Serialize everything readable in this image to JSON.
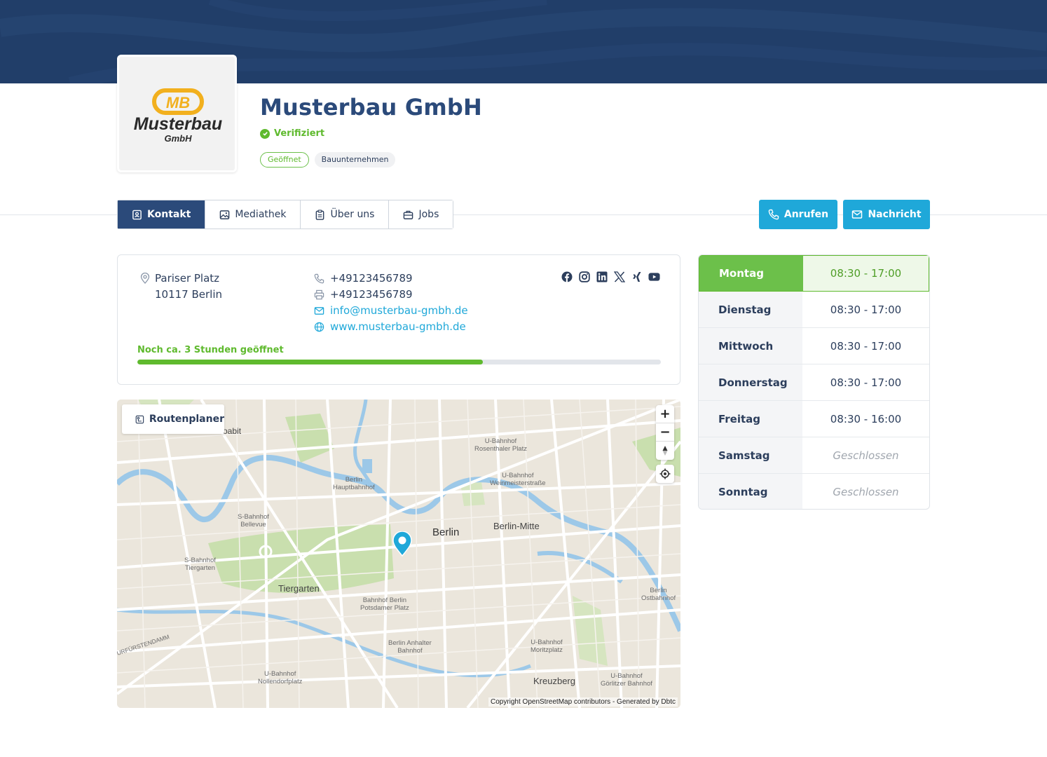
{
  "company": {
    "name": "Musterbau GmbH",
    "verified_label": "Verifiziert",
    "logo_text_main": "Musterbau",
    "logo_text_sub": "GmbH",
    "logo_monogram": "MB",
    "tags": {
      "status": "Geöffnet",
      "category": "Bauunternehmen"
    }
  },
  "tabs": [
    {
      "label": "Kontakt",
      "icon": "contact-card-icon",
      "active": true
    },
    {
      "label": "Mediathek",
      "icon": "image-icon"
    },
    {
      "label": "Über uns",
      "icon": "clipboard-icon"
    },
    {
      "label": "Jobs",
      "icon": "briefcase-icon"
    }
  ],
  "actions": {
    "call_label": "Anrufen",
    "message_label": "Nachricht"
  },
  "contact": {
    "street": "Pariser Platz",
    "city": "10117 Berlin",
    "phone": "+49123456789",
    "fax": "+49123456789",
    "email": "info@musterbau-gmbh.de",
    "website": "www.musterbau-gmbh.de",
    "open_note": "Noch ca. 3 Stunden geöffnet",
    "open_progress_percent": 66,
    "socials": [
      "facebook-icon",
      "instagram-icon",
      "linkedin-icon",
      "x-icon",
      "xing-icon",
      "youtube-icon"
    ]
  },
  "map": {
    "route_label": "Routenplaner",
    "attribution": "Copyright OpenStreetMap contributors - Generated by Dbtc",
    "zoom_in": "+",
    "zoom_out": "−",
    "labels": {
      "moabit": "...oabit",
      "rosenthaler_1": "U-Bahnhof",
      "rosenthaler_2": "Rosenthaler Platz",
      "weinmeister_1": "U-Bahnhof",
      "weinmeister_2": "Weinmeisterstraße",
      "hbf_1": "Berlin",
      "hbf_2": "Hauptbahnhof",
      "bellevue_1": "S-Bahnhof",
      "bellevue_2": "Bellevue",
      "berlin": "Berlin",
      "berlin_mitte": "Berlin-Mitte",
      "tiergarten_s_1": "S-Bahnhof",
      "tiergarten_s_2": "Tiergarten",
      "tiergarten": "Tiergarten",
      "potsdamer_1": "Bahnhof Berlin",
      "potsdamer_2": "Potsdamer Platz",
      "ostbahnhof_1": "Berlin",
      "ostbahnhof_2": "Ostbahnhof",
      "kudamm": "URFÜRSTENDAMM",
      "anhalter_1": "Berlin Anhalter",
      "anhalter_2": "Bahnhof",
      "moritzplatz_1": "U-Bahnhof",
      "moritzplatz_2": "Moritzplatz",
      "nollendorf_1": "U-Bahnhof",
      "nollendorf_2": "Nollendorfplatz",
      "kreuzberg": "Kreuzberg",
      "goerlitzer_1": "U-Bahnhof",
      "goerlitzer_2": "Görlitzer Bahnhof"
    }
  },
  "hours": [
    {
      "day": "Montag",
      "time": "08:30 - 17:00",
      "today": true
    },
    {
      "day": "Dienstag",
      "time": "08:30 - 17:00"
    },
    {
      "day": "Mittwoch",
      "time": "08:30 - 17:00"
    },
    {
      "day": "Donnerstag",
      "time": "08:30 - 17:00"
    },
    {
      "day": "Freitag",
      "time": "08:30 - 16:00"
    },
    {
      "day": "Samstag",
      "time": "Geschlossen",
      "closed": true
    },
    {
      "day": "Sonntag",
      "time": "Geschlossen",
      "closed": true
    }
  ],
  "colors": {
    "banner": "#213e69",
    "brand": "#2b4a7a",
    "accent": "#1fa8d9",
    "success": "#5fba2e",
    "logo_yellow": "#f2b01e"
  }
}
